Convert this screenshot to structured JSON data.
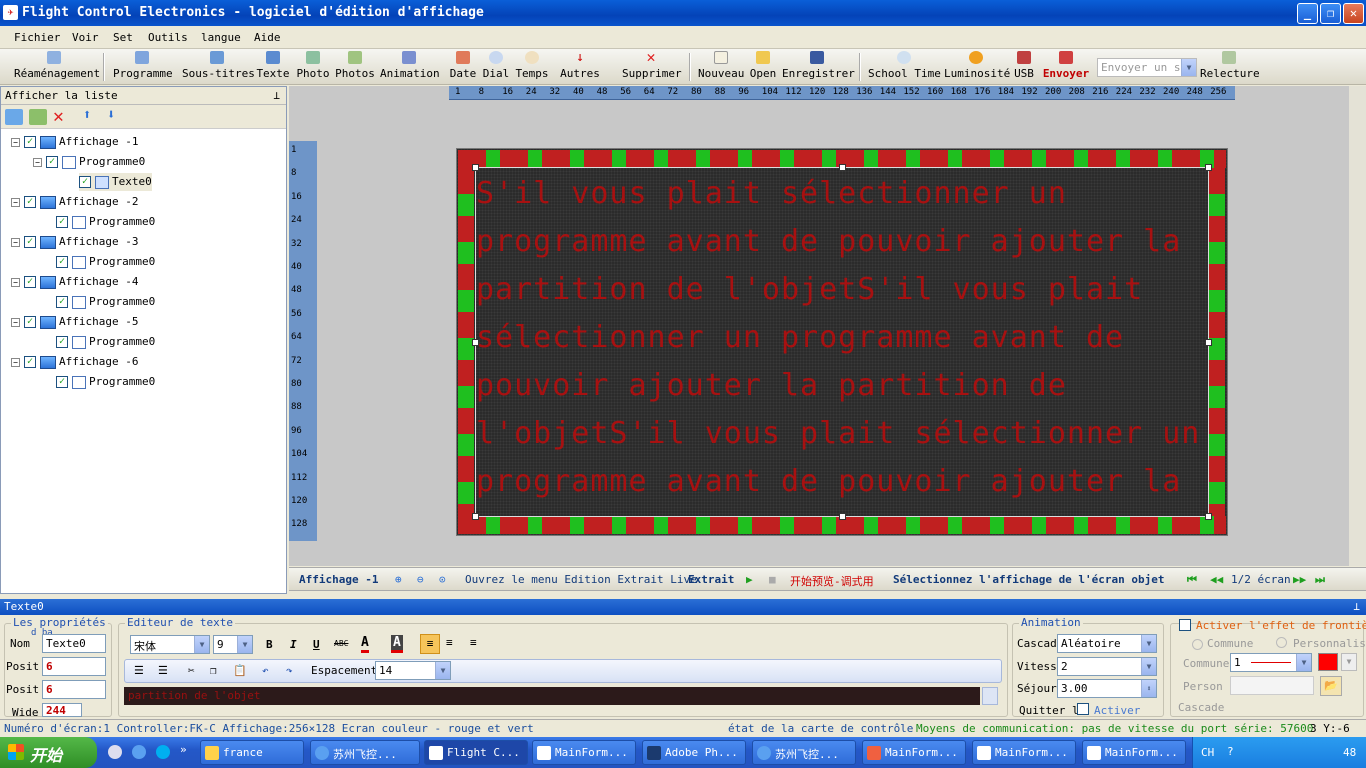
{
  "window": {
    "title": "Flight Control Electronics - logiciel d'édition d'affichage"
  },
  "menu": [
    "Fichier",
    "Voir",
    "Set",
    "Outils",
    "langue",
    "Aide"
  ],
  "toolbar": {
    "g1": [
      "Réaménagement"
    ],
    "g2": [
      "Programme",
      "Sous-titres",
      "Texte",
      "Photo",
      "Photos",
      "Animation",
      "Date",
      "Dial",
      "Temps",
      "Autres",
      "Supprimer"
    ],
    "g3": [
      "Nouveau",
      "Open",
      "Enregistrer"
    ],
    "g4": [
      "School Time",
      "Luminosité",
      "USB",
      "Envoyer"
    ],
    "send_combo": "Envoyer un se",
    "relecture": "Relecture"
  },
  "leftpanel": {
    "title": "Afficher la liste",
    "tree": [
      {
        "label": "Affichage -1",
        "children": [
          {
            "label": "Programme0",
            "children": [
              {
                "label": "Texte0"
              }
            ]
          }
        ]
      },
      {
        "label": "Affichage -2",
        "children": [
          {
            "label": "Programme0"
          }
        ]
      },
      {
        "label": "Affichage -3",
        "children": [
          {
            "label": "Programme0"
          }
        ]
      },
      {
        "label": "Affichage -4",
        "children": [
          {
            "label": "Programme0"
          }
        ]
      },
      {
        "label": "Affichage -5",
        "children": [
          {
            "label": "Programme0"
          }
        ]
      },
      {
        "label": "Affichage -6",
        "children": [
          {
            "label": "Programme0"
          }
        ]
      }
    ]
  },
  "ruler": {
    "h": [
      "1",
      "8",
      "16",
      "24",
      "32",
      "40",
      "48",
      "56",
      "64",
      "72",
      "80",
      "88",
      "96",
      "104",
      "112",
      "120",
      "128",
      "136",
      "144",
      "152",
      "160",
      "168",
      "176",
      "184",
      "192",
      "200",
      "208",
      "216",
      "224",
      "232",
      "240",
      "248",
      "256"
    ],
    "v": [
      "1",
      "8",
      "16",
      "24",
      "32",
      "40",
      "48",
      "56",
      "64",
      "72",
      "80",
      "88",
      "96",
      "104",
      "112",
      "120",
      "128"
    ]
  },
  "led": {
    "lines": [
      "S'il vous plait sélectionner un",
      "programme avant de pouvoir ajouter la",
      "partition de l'objetS'il vous plait",
      "sélectionner un programme avant de",
      "pouvoir ajouter la partition de",
      "l'objetS'il vous plait sélectionner un",
      "programme avant de pouvoir ajouter la"
    ],
    "text_color": "#b50e0e",
    "border_red": "#c02020",
    "border_green": "#1fbf1f"
  },
  "navbar": {
    "current": "Affichage -1",
    "menu_hint": "Ouvrez le menu Edition Extrait Live",
    "extrait": "Extrait",
    "preview": "开始预览-调式用",
    "select_hint": "Sélectionnez l'affichage de l'écran objet",
    "page": "1/2 écran"
  },
  "props": {
    "bar_title": "Texte0",
    "grp1_title": "Les propriétés",
    "grp1_sub": "d ba",
    "nom_label": "Nom",
    "nom_value": "Texte0",
    "posit1_label": "Posit",
    "posit1_value": "6",
    "posit2_label": "Posit",
    "posit2_value": "6",
    "wide_label": "Wide",
    "wide_value": "244",
    "editor_title": "Editeur de texte",
    "font": "宋体",
    "size": "9",
    "spacing_label": "Espacement",
    "spacing_value": "14",
    "edit_text": "partition de l'objet",
    "anim_title": "Animation",
    "cascad_label": "Cascad",
    "cascad_value": "Aléatoire",
    "vitess_label": "Vitess",
    "vitess_value": "2",
    "sejour_label": "Séjour",
    "sejour_value": "3.00",
    "quitter_label": "Quitter l",
    "activer": "Activer",
    "frontier_title": "Activer l'effet de frontière",
    "commune_radio": "Commune",
    "perso_radio": "Personnalis",
    "commune_label": "Commune",
    "commune_value": "1",
    "person_label": "Person",
    "cascade_label": "Cascade"
  },
  "status": {
    "s1": "Numéro d'écran:1 Controller:FK-C Affichage:256×128 Ecran couleur - rouge et vert",
    "s2": "état de la carte de contrôle",
    "s3": "Moyens de communication: pas de vitesse du port série: 57600",
    "s4": "3 Y:-6"
  },
  "taskbar": {
    "start": "开始",
    "tasks": [
      "france",
      "苏州飞控...",
      "Flight C...",
      "MainForm...",
      "Adobe Ph...",
      "苏州飞控...",
      "MainForm...",
      "MainForm...",
      "MainForm..."
    ],
    "tray_lang": "CH",
    "tray_time": "48"
  }
}
